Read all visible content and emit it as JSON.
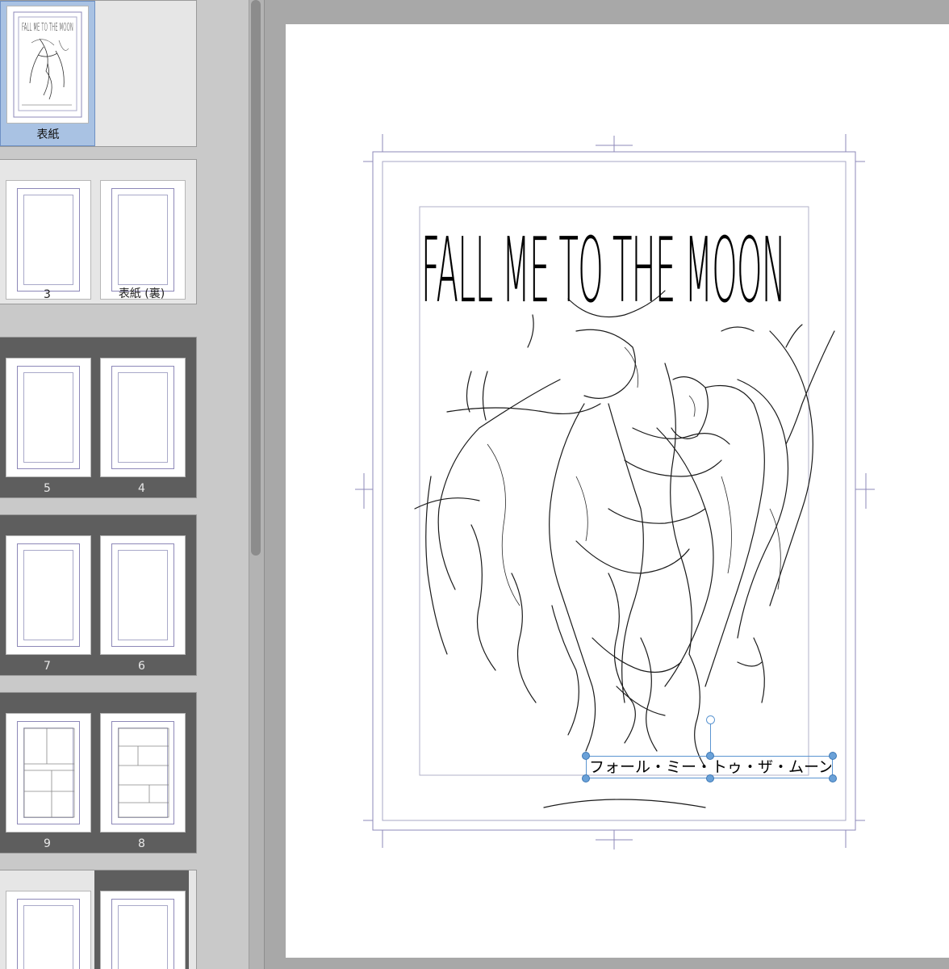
{
  "pages_panel": {
    "spreads": [
      {
        "id": "cover",
        "pages": [
          {
            "label": "表紙",
            "active": true,
            "has_art": true
          }
        ]
      },
      {
        "id": "spread-1",
        "pages": [
          {
            "label": "3"
          },
          {
            "label": "表紙 (裏)"
          }
        ]
      },
      {
        "id": "spread-2",
        "pages": [
          {
            "label": "5"
          },
          {
            "label": "4"
          }
        ]
      },
      {
        "id": "spread-3",
        "pages": [
          {
            "label": "7"
          },
          {
            "label": "6"
          }
        ]
      },
      {
        "id": "spread-4",
        "pages": [
          {
            "label": "9"
          },
          {
            "label": "8"
          }
        ]
      },
      {
        "id": "spread-5",
        "pages": [
          {
            "label": ""
          },
          {
            "label": ""
          }
        ]
      }
    ]
  },
  "canvas": {
    "cover_title": "FALL ME TO THE MOON",
    "cover_subtitle": "フォール・ミー・トゥ・ザ・ムーン"
  },
  "colors": {
    "panel_bg": "#c9c9c9",
    "canvas_bg": "#a8a8a8",
    "guide": "#8d88b8",
    "selection": "#5b95d1",
    "active_page": "#a9c2e3"
  }
}
